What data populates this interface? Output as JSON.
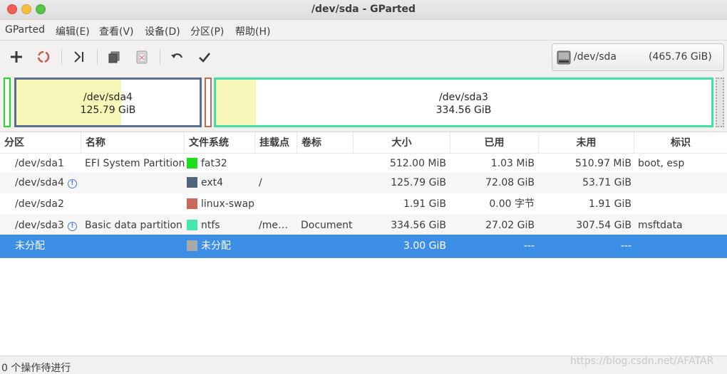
{
  "window": {
    "title": "/dev/sda - GParted"
  },
  "menubar": {
    "items": [
      {
        "label": "GParted"
      },
      {
        "label": "编辑(E)"
      },
      {
        "label": "查看(V)"
      },
      {
        "label": "设备(D)"
      },
      {
        "label": "分区(P)"
      },
      {
        "label": "帮助(H)"
      }
    ]
  },
  "toolbar": {
    "icons": [
      "add-icon",
      "delete-icon",
      "resize-icon",
      "copy-icon",
      "paste-icon",
      "undo-icon",
      "apply-icon"
    ]
  },
  "device": {
    "name": "/dev/sda",
    "size": "(465.76 GiB)"
  },
  "disk_map": {
    "sda4": {
      "name": "/dev/sda4",
      "size": "125.79 GiB",
      "color": "#5a6d8a",
      "used_fraction": 0.573
    },
    "sda3": {
      "name": "/dev/sda3",
      "size": "334.56 GiB",
      "color": "#45e0a7",
      "used_fraction": 0.081
    },
    "colors": {
      "fat32": "#1fdc1f",
      "swap": "#b86b5e",
      "unallocated": "#a6a6a6",
      "used_fill": "#f8f7b8"
    }
  },
  "table": {
    "headers": [
      "分区",
      "名称",
      "文件系统",
      "挂载点",
      "卷标",
      "大小",
      "已用",
      "未用",
      "标识"
    ],
    "rows": [
      {
        "partition": "/dev/sda1",
        "name": "EFI System Partition",
        "fs": "fat32",
        "fs_color": "#1fdc1f",
        "mount": "",
        "label": "",
        "size": "512.00 MiB",
        "used": "1.03 MiB",
        "unused": "510.97 MiB",
        "flags": "boot, esp",
        "warn": false
      },
      {
        "partition": "/dev/sda4",
        "name": "",
        "fs": "ext4",
        "fs_color": "#50647c",
        "mount": "/",
        "label": "",
        "size": "125.79 GiB",
        "used": "72.08 GiB",
        "unused": "53.71 GiB",
        "flags": "",
        "warn": true
      },
      {
        "partition": "/dev/sda2",
        "name": "",
        "fs": "linux-swap",
        "fs_color": "#c86a5e",
        "mount": "",
        "label": "",
        "size": "1.91 GiB",
        "used": "0.00 字节",
        "unused": "1.91 GiB",
        "flags": "",
        "warn": false
      },
      {
        "partition": "/dev/sda3",
        "name": "Basic data partition",
        "fs": "ntfs",
        "fs_color": "#45e6a9",
        "mount": "/me…",
        "label": "Document",
        "size": "334.56 GiB",
        "used": "27.02 GiB",
        "unused": "307.54 GiB",
        "flags": "msftdata",
        "warn": true
      },
      {
        "partition": "未分配",
        "name": "",
        "fs": "未分配",
        "fs_color": "#a8a8a8",
        "mount": "",
        "label": "",
        "size": "3.00 GiB",
        "used": "---",
        "unused": "---",
        "flags": "",
        "warn": false
      }
    ]
  },
  "status": {
    "text": "0 个操作待进行"
  },
  "watermark": "https://blog.csdn.net/AFATAR"
}
